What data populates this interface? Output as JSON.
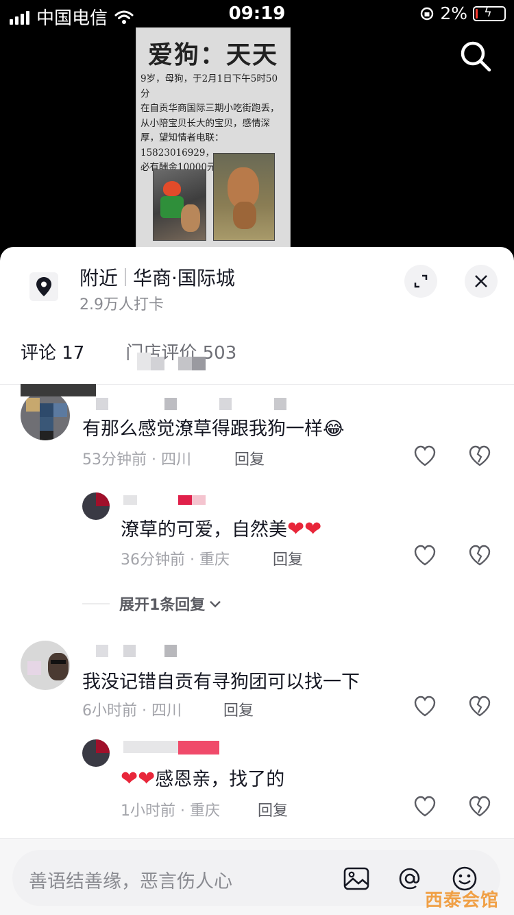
{
  "status_bar": {
    "carrier": "中国电信",
    "time": "09:19",
    "battery": "2%"
  },
  "poster": {
    "title": "爱狗：天天",
    "lines": [
      "9岁，母狗，于2月1日下午5时50分",
      "在自贡华商国际三期小吃街跑丢，",
      "从小陪宝贝长大的宝贝，感情深",
      "厚，望知情者电联：15823016929，",
      "必有酬金10000元。"
    ]
  },
  "sheet": {
    "location_prefix": "附近",
    "location_name": "华商·国际城",
    "checkins": "2.9万人打卡",
    "tabs": [
      {
        "label": "评论 17"
      },
      {
        "label": "门店评价 503"
      }
    ]
  },
  "comments": [
    {
      "text": "有那么感觉潦草得跟我狗一样",
      "emoji": "😂",
      "time_loc": "53分钟前 · 四川",
      "reply_label": "回复"
    },
    {
      "text": "潦草的可爱，自然美",
      "hearts": "❤❤",
      "time_loc": "36分钟前 · 重庆",
      "reply_label": "回复"
    },
    {
      "expand_label": "展开1条回复"
    },
    {
      "text": "我没记错自贡有寻狗团可以找一下",
      "time_loc": "6小时前 · 四川",
      "reply_label": "回复"
    },
    {
      "hearts": "❤❤",
      "text": "感恩亲，找了的",
      "time_loc": "1小时前 · 重庆",
      "reply_label": "回复"
    }
  ],
  "input": {
    "placeholder": "善语结善缘，恶言伤人心"
  },
  "watermark": "西泰会馆"
}
